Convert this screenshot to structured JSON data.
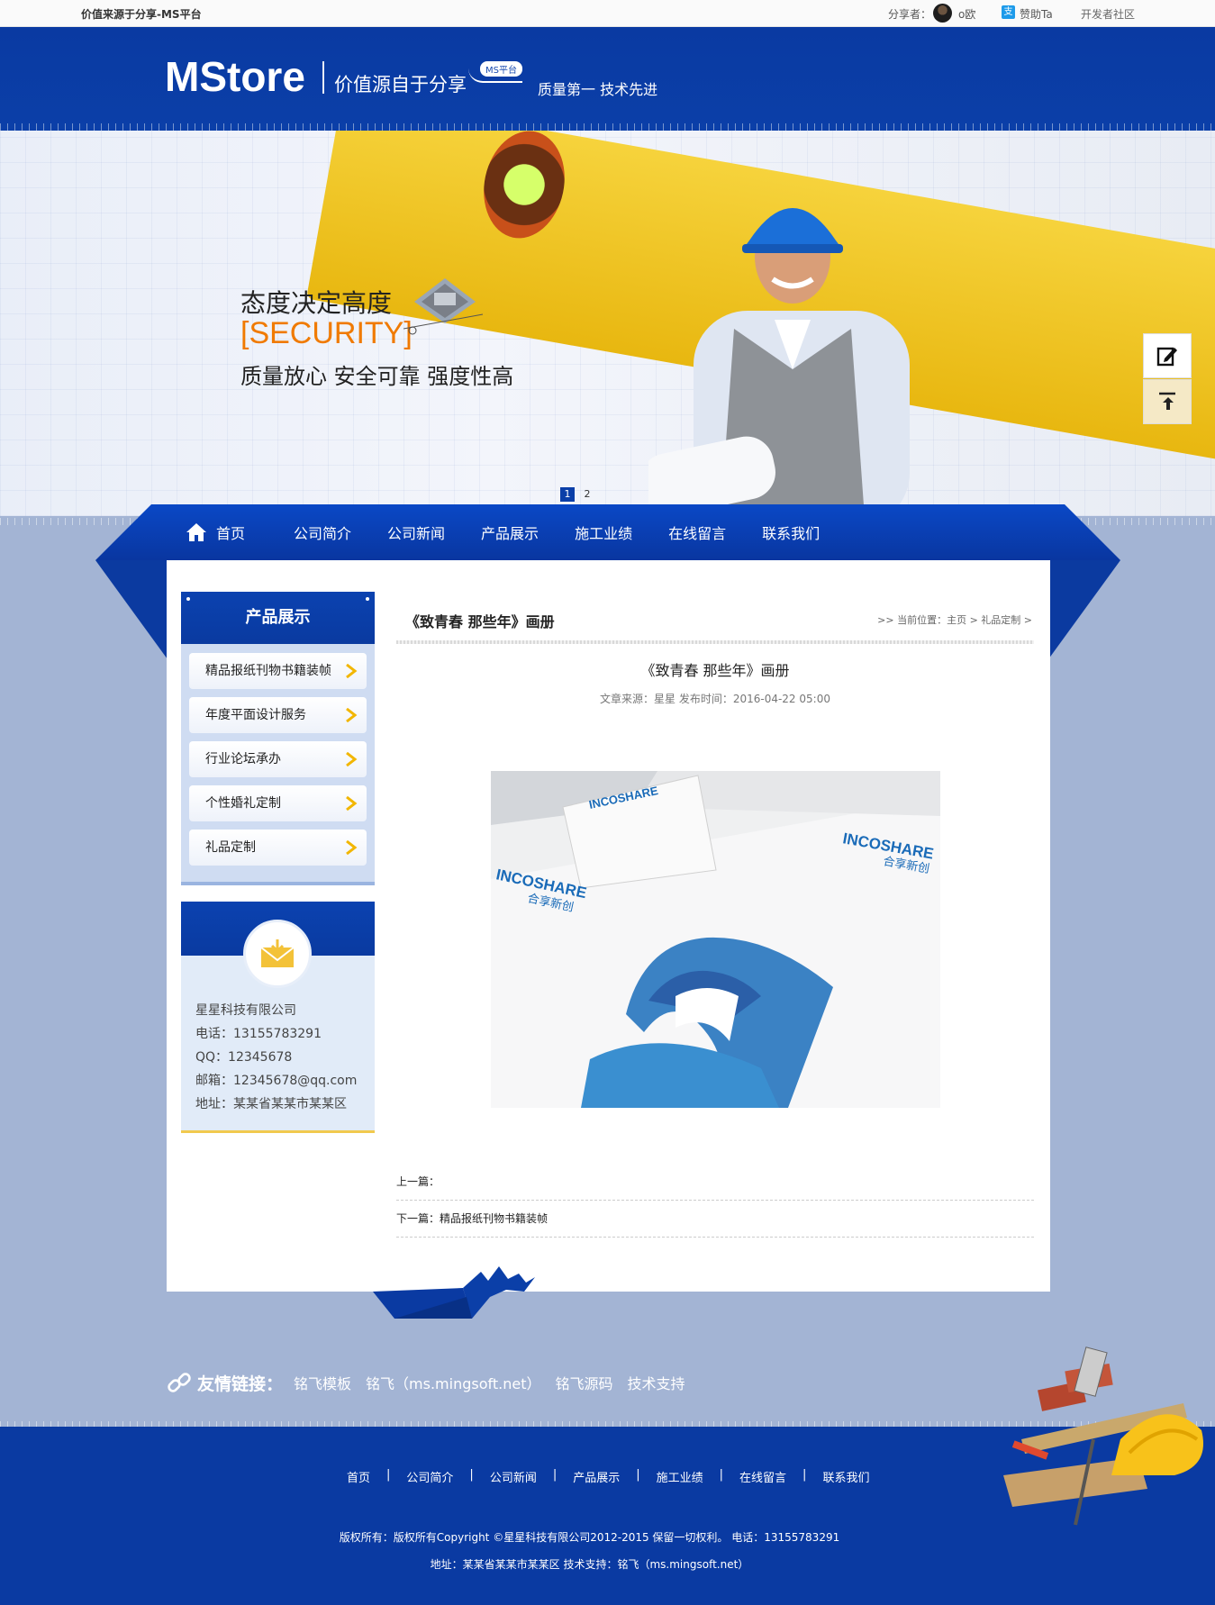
{
  "topbar": {
    "site_slogan": "价值来源于分享-MS平台",
    "sharer_label": "分享者：",
    "sharer_name": "o欧",
    "sponsor": "赞助Ta",
    "dev_community": "开发者社区"
  },
  "header": {
    "logo": "MStore",
    "slogan": "价值源自于分享",
    "badge": "MS平台",
    "motto": "质量第一 技术先进"
  },
  "banner": {
    "tagline": "态度决定高度",
    "security": "[SECURITY]",
    "quality": "质量放心 安全可靠 强度性高",
    "slides": [
      "1",
      "2"
    ],
    "active_slide": "1"
  },
  "nav": {
    "items": [
      "首页",
      "公司简介",
      "公司新闻",
      "产品展示",
      "施工业绩",
      "在线留言",
      "联系我们"
    ]
  },
  "sidebar": {
    "products_title": "产品展示",
    "products": [
      "精品报纸刊物书籍装帧",
      "年度平面设计服务",
      "行业论坛承办",
      "个性婚礼定制",
      "礼品定制"
    ],
    "contact": {
      "company": "星星科技有限公司",
      "phone": "电话：13155783291",
      "qq": "QQ：12345678",
      "email": "邮箱：12345678@qq.com",
      "address": "地址：某某省某某市某某区"
    }
  },
  "article": {
    "bar_title": "《致青春 那些年》画册",
    "breadcrumb": ">> 当前位置：主页 > 礼品定制 >",
    "heading": "《致青春 那些年》画册",
    "meta": "文章来源：星星 发布时间：2016-04-22 05:00",
    "image_brand_en": "INCOSHARE",
    "image_brand_cn": "合享新创",
    "prev": "上一篇：",
    "next": "下一篇：精品报纸刊物书籍装帧"
  },
  "friends": {
    "label": "友情链接：",
    "links": [
      "铭飞模板",
      "铭飞（ms.mingsoft.net）",
      "铭飞源码",
      "技术支持"
    ]
  },
  "footer": {
    "nav": [
      "首页",
      "公司简介",
      "公司新闻",
      "产品展示",
      "施工业绩",
      "在线留言",
      "联系我们"
    ],
    "separator": "|",
    "copyright": "版权所有：版权所有Copyright ©星星科技有限公司2012-2015 保留一切权利。   电话：13155783291",
    "address_line": "地址：某某省某某市某某区    技术支持：铭飞（ms.mingsoft.net）"
  },
  "colors": {
    "primary_blue": "#0a3aa2",
    "page_bg": "#a3b4d4",
    "accent_orange": "#f07a00",
    "accent_yellow": "#f1c94e"
  }
}
